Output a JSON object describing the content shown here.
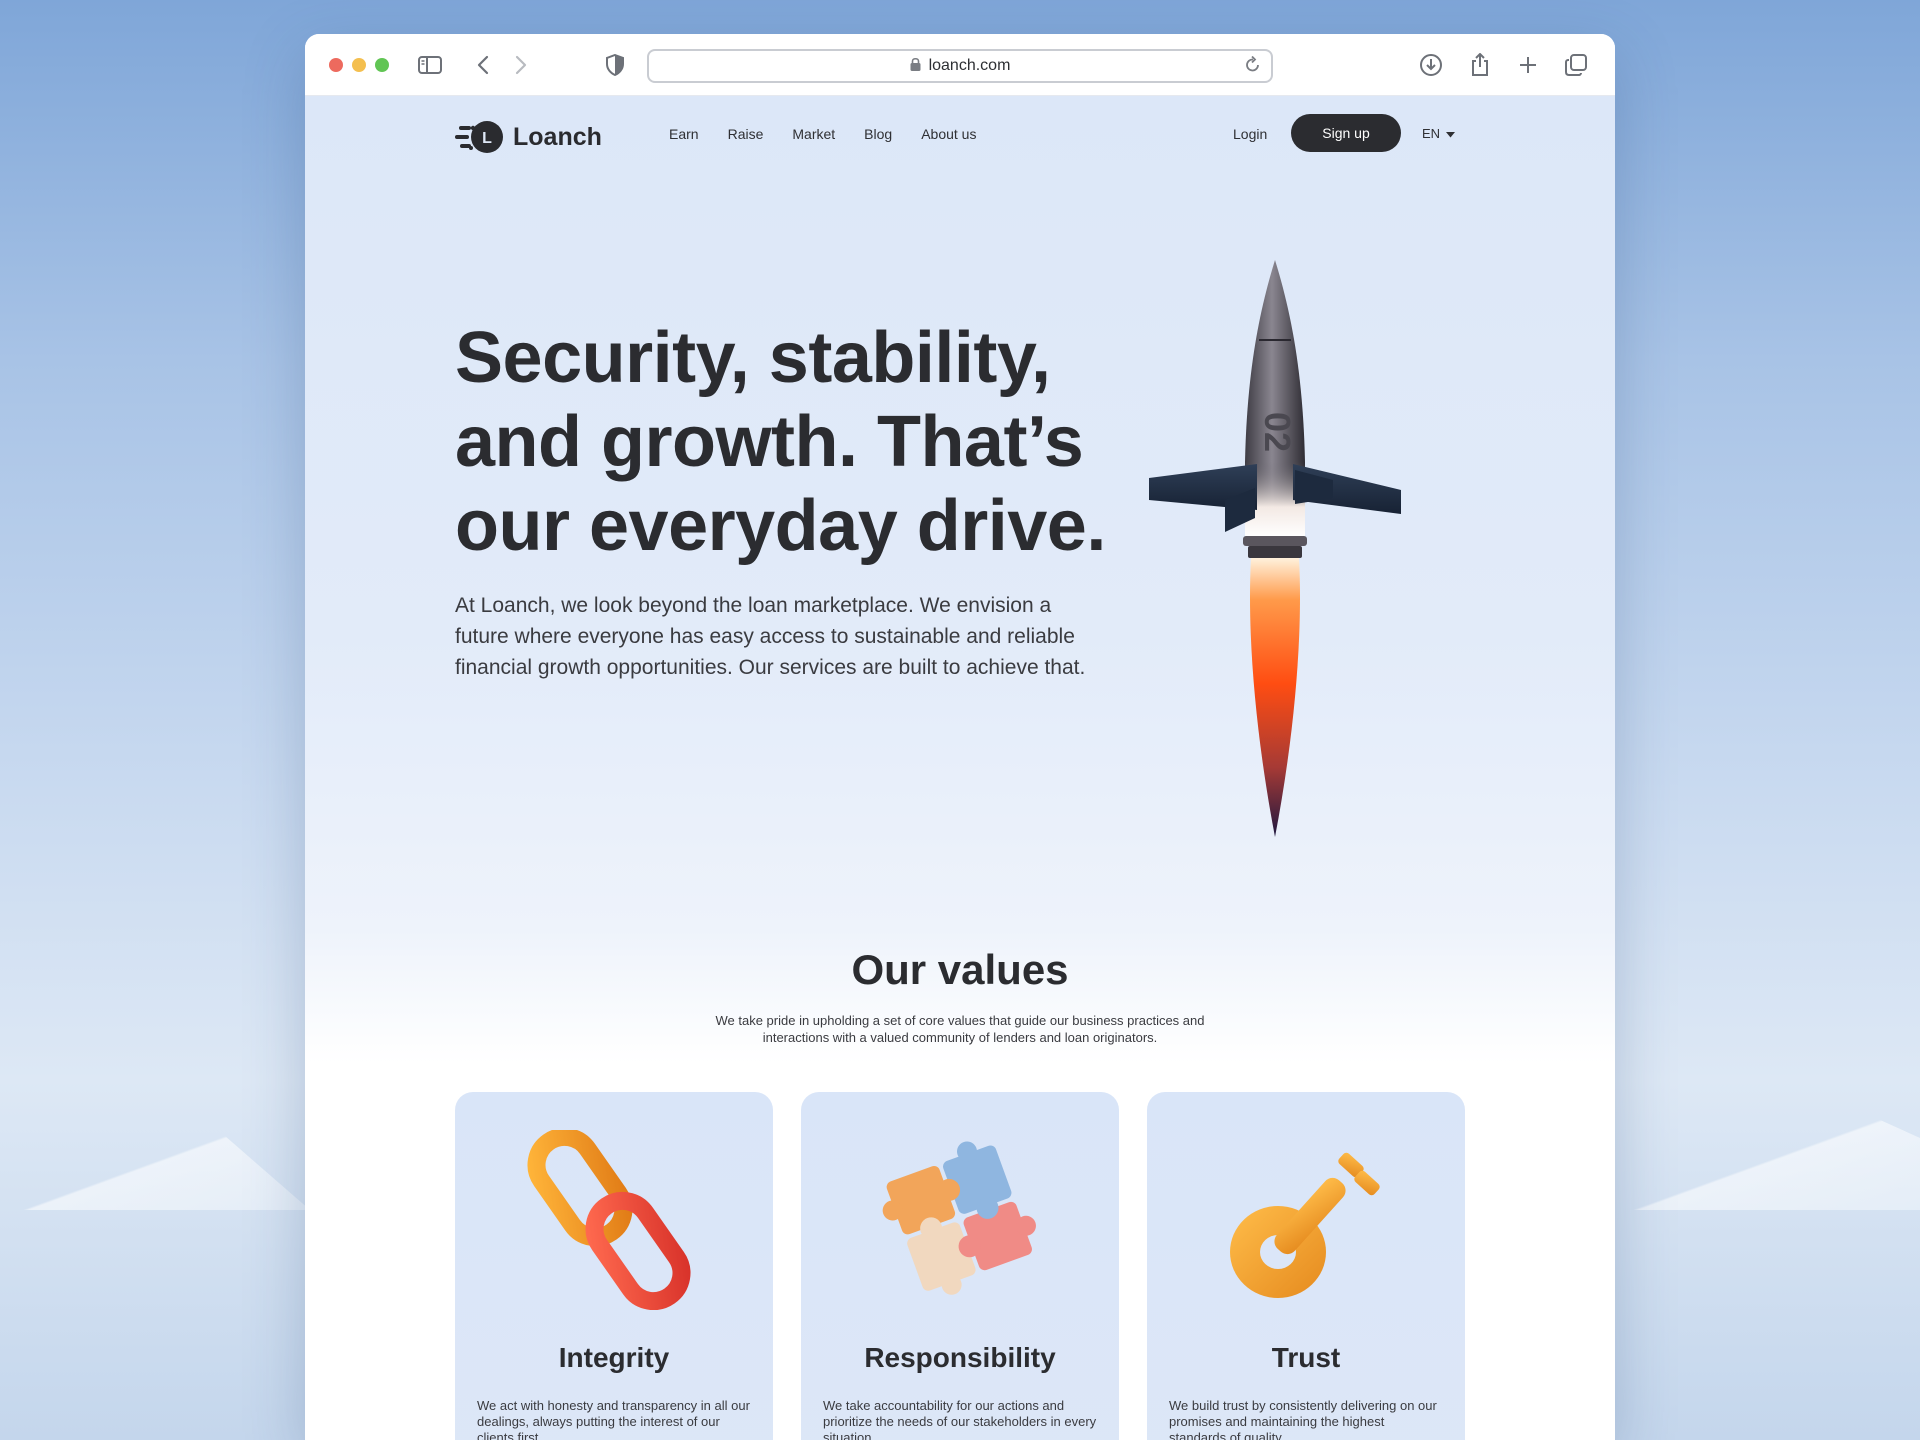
{
  "browser": {
    "url": "loanch.com",
    "icons": [
      "sidebar-icon",
      "back-icon",
      "forward-icon",
      "shield-icon",
      "lock-icon",
      "reload-icon",
      "download-icon",
      "share-icon",
      "new-tab-icon",
      "tabs-overview-icon"
    ]
  },
  "nav": {
    "brand": "Loanch",
    "links": [
      "Earn",
      "Raise",
      "Market",
      "Blog",
      "About us"
    ],
    "login": "Login",
    "signup": "Sign up",
    "language": "EN"
  },
  "hero": {
    "title": "Security, stability, and growth. That’s our everyday drive.",
    "text": "At Loanch, we look beyond the loan marketplace. We envision a future where everyone has easy access to sustainable and reliable financial growth opportunities. Our services are built to achieve that.",
    "rocket_number": "02"
  },
  "values": {
    "title": "Our values",
    "subtitle": "We take pride in upholding a set of core values that guide our business practices and interactions with a valued community of lenders and loan originators.",
    "cards": [
      {
        "icon": "chain-icon",
        "title": "Integrity",
        "text": "We act with honesty and transparency in all our dealings, always putting the interest of our clients first."
      },
      {
        "icon": "puzzle-icon",
        "title": "Responsibility",
        "text": "We take accountability for our actions and prioritize the needs of our stakeholders in every situation."
      },
      {
        "icon": "key-icon",
        "title": "Trust",
        "text": "We build trust by consistently delivering on our promises and maintaining the highest standards of quality."
      }
    ]
  },
  "colors": {
    "accent_dark": "#2b2c30",
    "flame_orange": "#ff5a1f",
    "card_bg": "#dbe6f8"
  }
}
